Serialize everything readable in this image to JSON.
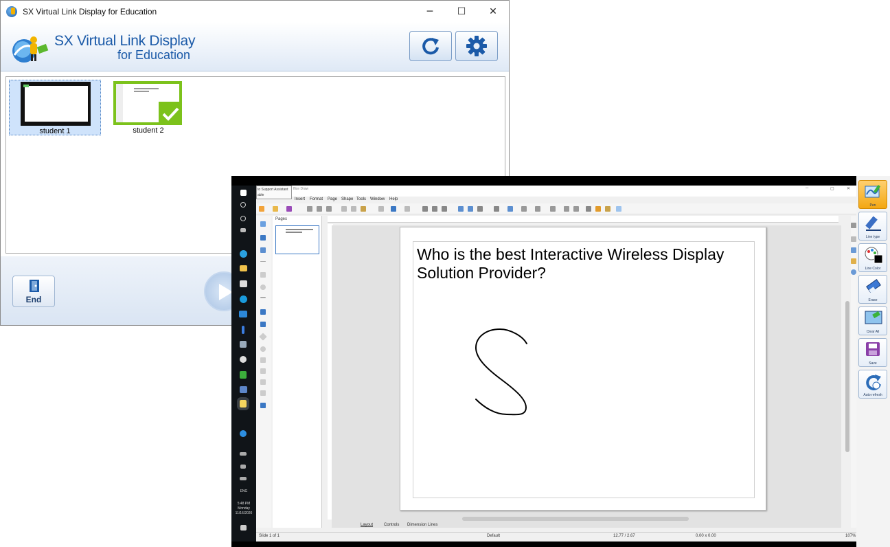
{
  "main_window": {
    "title": "SX Virtual Link Display for Education",
    "logo_title": "SX Virtual Link Display",
    "logo_subtitle": "for Education",
    "caption": {
      "minimize": "─",
      "maximize": "☐",
      "close": "✕"
    },
    "header_buttons": {
      "refresh_icon": "refresh-icon",
      "settings_icon": "gear-icon"
    },
    "students": [
      {
        "name": "student 1",
        "selected": true,
        "shared": false
      },
      {
        "name": "student 2",
        "selected": false,
        "shared": true
      }
    ],
    "end_label": "End"
  },
  "shared_screen": {
    "taskbar": {
      "lang": "ENG",
      "time": "5:48 PM",
      "day": "Monday",
      "date": "11/16/2020"
    },
    "draw_app": {
      "title_fragment": "ffice Draw",
      "tooltip": "to Support Assistant",
      "tooltip2": "able",
      "menu": [
        "Insert",
        "Format",
        "Page",
        "Shape",
        "Tools",
        "Window",
        "Help"
      ],
      "pages_label": "Pages",
      "slide_text": "Who is the best Interactive Wireless Display Solution Provider?",
      "tabs": [
        "Layout",
        "Controls",
        "Dimension Lines"
      ],
      "status": {
        "slide": "Slide 1 of 1",
        "layout": "Default",
        "position": "12.77 / 2.67",
        "size": "0.00 x 0.00",
        "zoom": "107%"
      }
    },
    "annotation_tools": [
      {
        "label": "Pen",
        "active": true,
        "icon": "pen-icon"
      },
      {
        "label": "Line type",
        "active": false,
        "icon": "line-type-icon"
      },
      {
        "label": "Line Color",
        "active": false,
        "icon": "palette-icon"
      },
      {
        "label": "Erase",
        "active": false,
        "icon": "eraser-icon"
      },
      {
        "label": "Clear All",
        "active": false,
        "icon": "clear-all-icon"
      },
      {
        "label": "Save",
        "active": false,
        "icon": "save-icon"
      },
      {
        "label": "Auto refresh",
        "active": false,
        "icon": "auto-refresh-icon"
      }
    ]
  },
  "colors": {
    "brand_blue": "#1b5aa8",
    "check_green": "#7cc21b",
    "pen_active": "#f3a712"
  }
}
